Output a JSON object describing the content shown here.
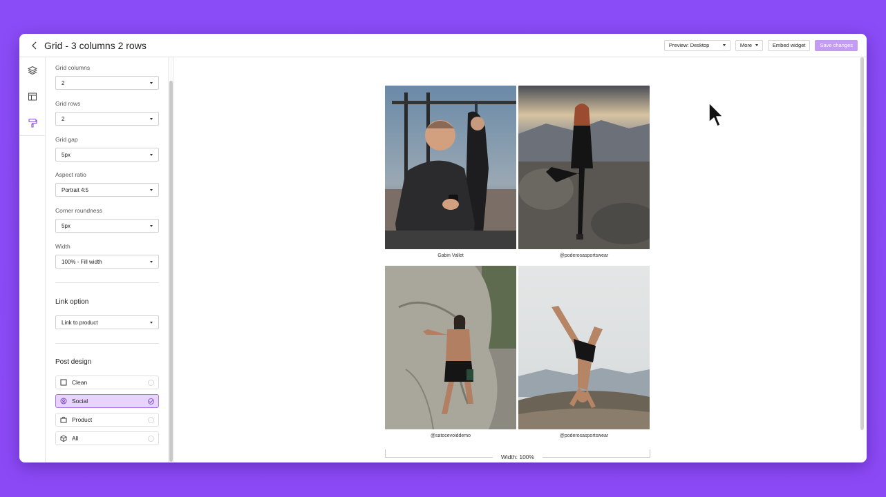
{
  "header": {
    "title": "Grid - 3 columns 2 rows",
    "preview_label": "Preview: Desktop",
    "more_label": "More",
    "embed_label": "Embed widget",
    "save_label": "Save changes"
  },
  "rail": {
    "items": [
      {
        "icon": "layers-icon"
      },
      {
        "icon": "layout-icon"
      },
      {
        "icon": "paint-roller-icon",
        "active": true
      }
    ]
  },
  "settings": {
    "grid_columns": {
      "label": "Grid columns",
      "value": "2"
    },
    "grid_rows": {
      "label": "Grid rows",
      "value": "2"
    },
    "grid_gap": {
      "label": "Grid gap",
      "value": "5px"
    },
    "aspect_ratio": {
      "label": "Aspect ratio",
      "value": "Portrait 4:5"
    },
    "corner_roundness": {
      "label": "Corner roundness",
      "value": "5px"
    },
    "width": {
      "label": "Width",
      "value": "100% - Fill width"
    }
  },
  "link_option": {
    "title": "Link option",
    "value": "Link to product"
  },
  "post_design": {
    "title": "Post design",
    "options": [
      {
        "label": "Clean",
        "icon": "square-icon",
        "selected": false
      },
      {
        "label": "Social",
        "icon": "user-circle-icon",
        "selected": true
      },
      {
        "label": "Product",
        "icon": "shopping-bag-icon",
        "selected": false
      },
      {
        "label": "All",
        "icon": "box-icon",
        "selected": false
      }
    ]
  },
  "preview": {
    "posts": [
      {
        "caption": "Gabin Vallet"
      },
      {
        "caption": "@poderosasportswear"
      },
      {
        "caption": "@satocevoiddemo"
      },
      {
        "caption": "@poderosasportswear"
      }
    ],
    "width_indicator": "Width: 100%"
  },
  "colors": {
    "background": "#8a4cf7",
    "accent": "#a875ea",
    "accent_light": "#e7d3fb",
    "save_button": "#c39cf1"
  }
}
